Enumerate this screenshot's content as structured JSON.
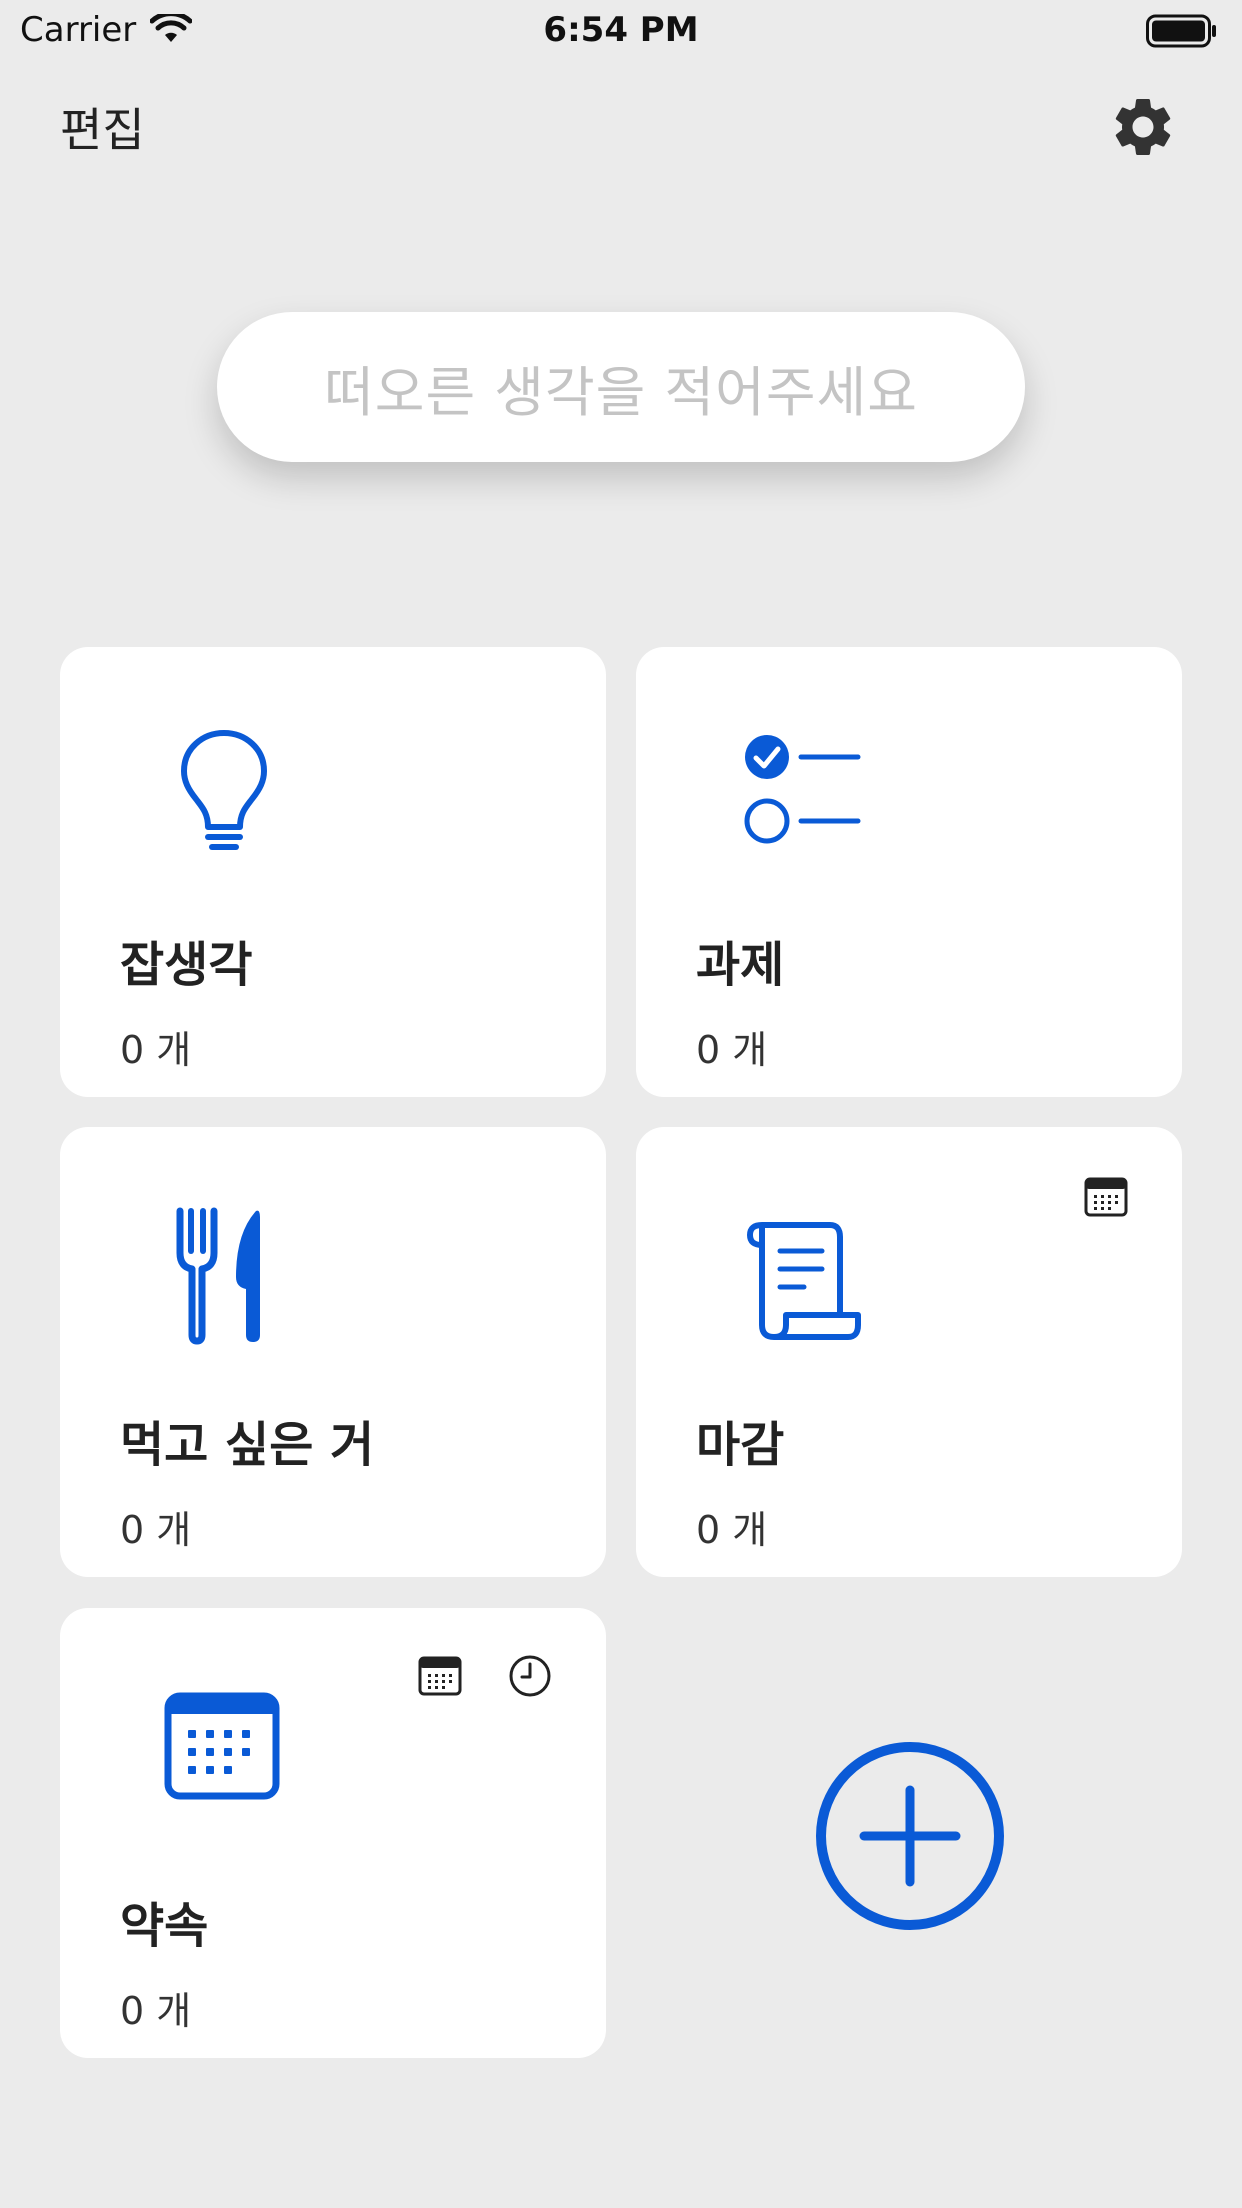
{
  "status_bar": {
    "carrier": "Carrier",
    "time": "6:54 PM"
  },
  "header": {
    "edit_label": "편집",
    "settings_icon": "gear-icon"
  },
  "idea_input": {
    "placeholder": "떠오른 생각을 적어주세요"
  },
  "categories": [
    {
      "title": "잡생각",
      "count": "0 개",
      "icon": "lightbulb-icon"
    },
    {
      "title": "과제",
      "count": "0 개",
      "icon": "checklist-icon"
    },
    {
      "title": "먹고 싶은 거",
      "count": "0 개",
      "icon": "fork-knife-icon"
    },
    {
      "title": "마감",
      "count": "0 개",
      "icon": "scroll-icon",
      "badges": [
        "calendar-icon"
      ]
    },
    {
      "title": "약속",
      "count": "0 개",
      "icon": "calendar-icon",
      "badges": [
        "calendar-icon",
        "clock-icon"
      ]
    }
  ],
  "add_category_icon": "plus-circle-icon",
  "colors": {
    "accent": "#0a5ad6",
    "background": "#ebebeb",
    "card": "#ffffff",
    "placeholder": "#c4c4c4"
  }
}
